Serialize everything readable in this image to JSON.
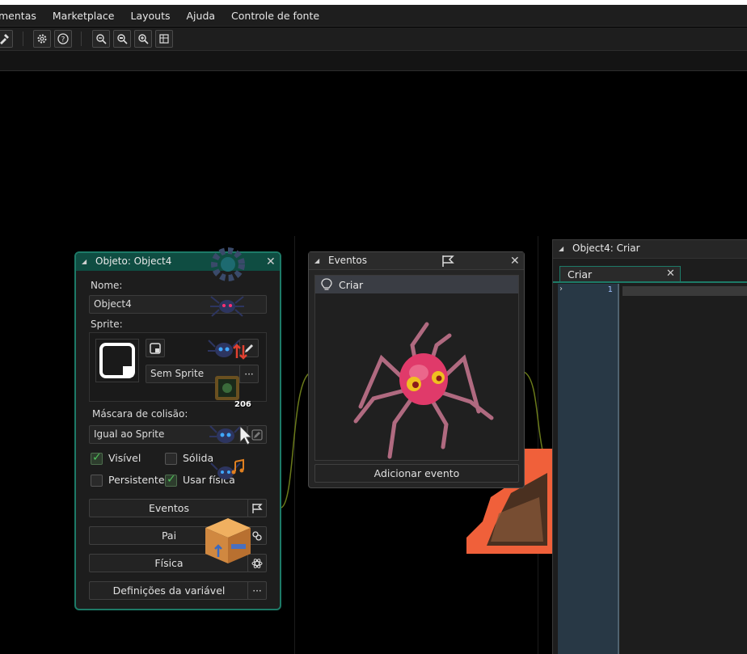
{
  "menu": [
    "mentas",
    "Marketplace",
    "Layouts",
    "Ajuda",
    "Controle de fonte"
  ],
  "toolbar_icons": [
    "paint-icon",
    "gear-icon",
    "help-icon",
    "zoom-out-icon",
    "zoom-reset-icon",
    "zoom-in-icon",
    "grid-icon"
  ],
  "object_panel": {
    "title": "Objeto: Object4",
    "name_label": "Nome:",
    "name_value": "Object4",
    "sprite_label": "Sprite:",
    "sprite_value": "Sem Sprite",
    "sprite_more": "···",
    "mask_label": "Máscara de colisão:",
    "mask_value": "Igual ao Sprite",
    "visible_label": "Visível",
    "visible_checked": true,
    "solid_label": "Sólida",
    "solid_checked": false,
    "persistent_label": "Persistente",
    "persistent_checked": false,
    "physics_label": "Usar física",
    "physics_checked": true,
    "events_button": "Eventos",
    "parent_button": "Pai",
    "physics_button": "Física",
    "variables_button": "Definições da variável",
    "variables_more": "···",
    "overlay_counter": "206"
  },
  "events_panel": {
    "title": "Eventos",
    "event_item": "Criar",
    "add_button": "Adicionar evento"
  },
  "code_panel": {
    "title": "Object4: Criar",
    "tab_label": "Criar",
    "line_number": "1"
  },
  "colors": {
    "accent": "#1d7a67",
    "background": "#000000",
    "panel": "#1d1d1d"
  }
}
